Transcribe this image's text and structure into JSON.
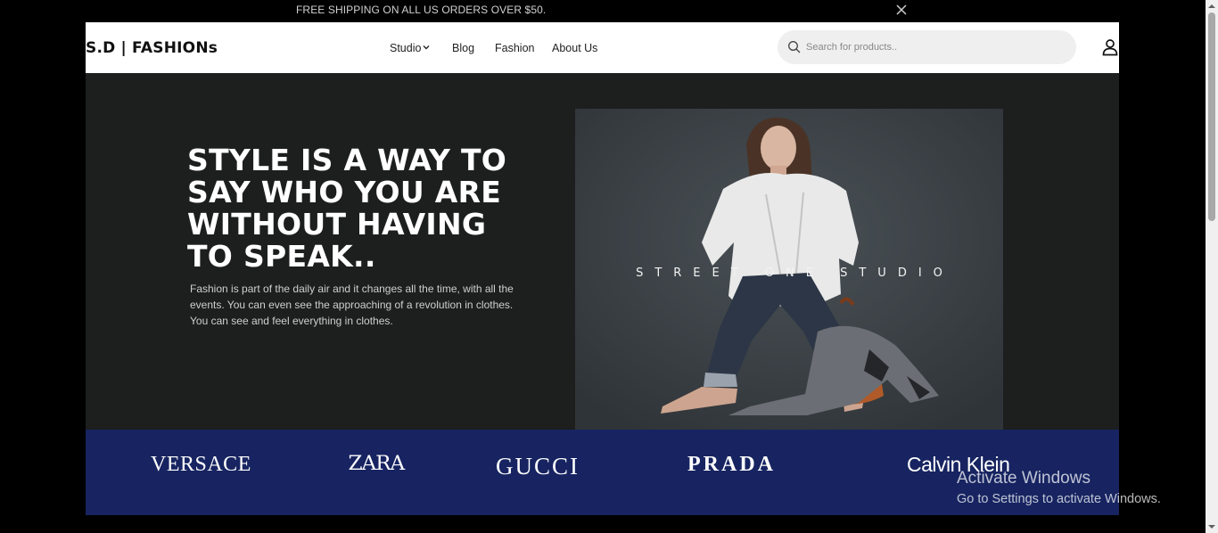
{
  "announcement": {
    "text": "FREE SHIPPING ON ALL US ORDERS OVER $50.",
    "close_icon": "close-icon"
  },
  "header": {
    "logo": "S.D | FASHIONs",
    "nav": [
      {
        "label": "Studio",
        "has_dropdown": true
      },
      {
        "label": "Blog"
      },
      {
        "label": "Fashion"
      },
      {
        "label": "About Us"
      }
    ],
    "search": {
      "placeholder": "Search for products..",
      "value": "",
      "icon": "search-icon"
    },
    "user_icon": "user-icon"
  },
  "hero": {
    "headline": "STYLE IS A WAY TO SAY WHO YOU ARE WITHOUT HAVING TO SPEAK..",
    "subtext": "Fashion is part of the daily air and it changes all the time, with all the events. You can even see the approaching of a revolution in clothes. You can see and feel everything in clothes.",
    "image_overlay_text": "STREET ONE STUDIO"
  },
  "brands": [
    "VERSACE",
    "ZARA",
    "GUCCI",
    "PRADA",
    "Calvin Klein"
  ],
  "os_watermark": {
    "line1": "Activate Windows",
    "line2": "Go to Settings to activate Windows."
  },
  "colors": {
    "hero_bg": "#1d1e1e",
    "brand_strip_bg": "#172461",
    "header_bg": "#ffffff",
    "page_bg": "#000000"
  }
}
